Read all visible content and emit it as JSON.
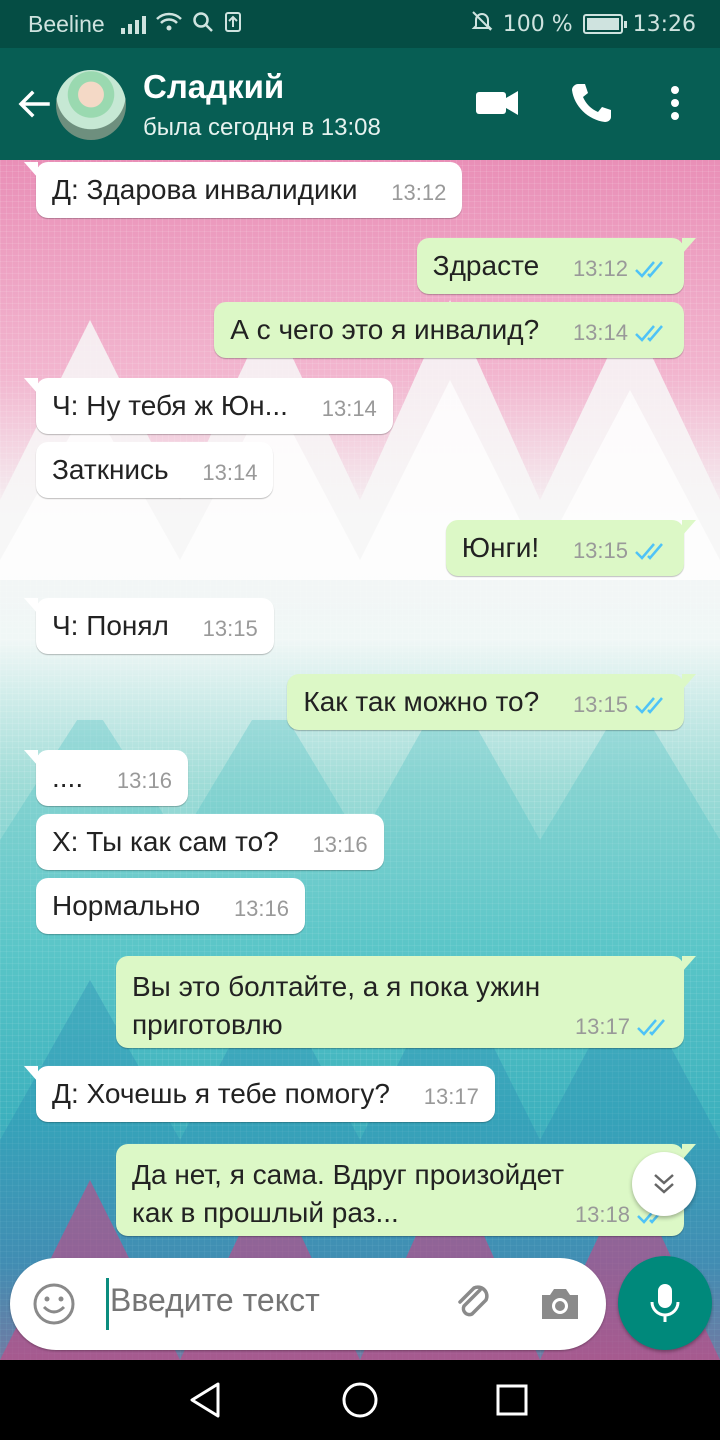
{
  "status_bar": {
    "carrier": "Beeline",
    "battery": "100 %",
    "battery_level": 1.0,
    "time": "13:26"
  },
  "header": {
    "contact_name": "Сладкий",
    "last_seen": "была сегодня в 13:08",
    "icons": [
      "back-arrow-icon",
      "video-call-icon",
      "phone-icon",
      "more-vert-icon"
    ]
  },
  "colors": {
    "header": "#075e54",
    "status_bar": "#054d44",
    "incoming_bubble": "#ffffff",
    "outgoing_bubble": "#dcf8c6",
    "read_ticks": "#4fc3f7",
    "accent": "#00897b"
  },
  "messages": [
    {
      "dir": "in",
      "text": "Д: Здарова инвалидики",
      "time": "13:12"
    },
    {
      "dir": "out",
      "text": "Здрасте",
      "time": "13:12",
      "read": true
    },
    {
      "dir": "out",
      "text": "А с чего это я инвалид?",
      "time": "13:14",
      "read": true
    },
    {
      "dir": "in",
      "text": "Ч: Ну тебя ж Юн...",
      "time": "13:14"
    },
    {
      "dir": "in",
      "text": "Заткнись",
      "time": "13:14"
    },
    {
      "dir": "out",
      "text": "Юнги!",
      "time": "13:15",
      "read": true
    },
    {
      "dir": "in",
      "text": "Ч: Понял",
      "time": "13:15"
    },
    {
      "dir": "out",
      "text": "Как так можно то?",
      "time": "13:15",
      "read": true
    },
    {
      "dir": "in",
      "text": "....",
      "time": "13:16"
    },
    {
      "dir": "in",
      "text": "Х: Ты как сам то?",
      "time": "13:16"
    },
    {
      "dir": "in",
      "text": "Нормально",
      "time": "13:16"
    },
    {
      "dir": "out",
      "lines": [
        "Вы это болтайте, а я пока ужин",
        "приготовлю"
      ],
      "time": "13:17",
      "read": true
    },
    {
      "dir": "in",
      "text": "Д: Хочешь я тебе помогу?",
      "time": "13:17"
    },
    {
      "dir": "out",
      "lines": [
        "Да нет, я сама. Вдруг произойдет",
        "как в прошлый раз..."
      ],
      "time": "13:18",
      "read": true
    }
  ],
  "composer": {
    "placeholder": "Введите текст",
    "icons": [
      "emoji-icon",
      "attach-icon",
      "camera-icon",
      "mic-icon",
      "scroll-down-icon"
    ]
  },
  "nav_bar": {
    "icons": [
      "nav-back-icon",
      "nav-home-icon",
      "nav-recents-icon"
    ]
  }
}
